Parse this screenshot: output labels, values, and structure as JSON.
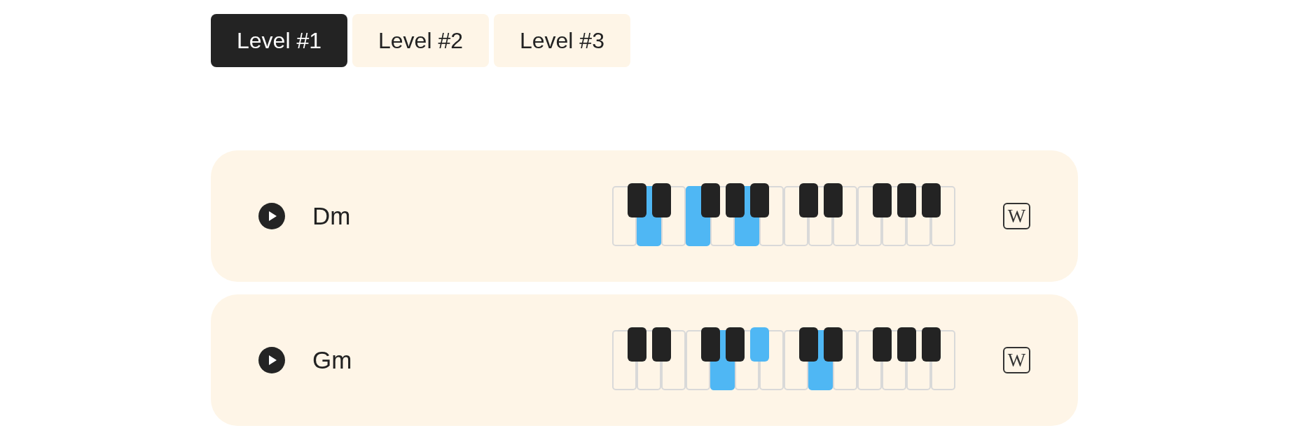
{
  "tabs": [
    {
      "label": "Level #1",
      "selected": true
    },
    {
      "label": "Level #2",
      "selected": false
    },
    {
      "label": "Level #3",
      "selected": false
    }
  ],
  "chords": [
    {
      "name": "Dm",
      "wiki_label": "W",
      "keys": [
        {
          "kind": "white",
          "highlighted": false
        },
        {
          "kind": "black",
          "highlighted": false
        },
        {
          "kind": "white",
          "highlighted": true
        },
        {
          "kind": "black",
          "highlighted": false
        },
        {
          "kind": "white",
          "highlighted": false
        },
        {
          "kind": "white",
          "highlighted": true
        },
        {
          "kind": "black",
          "highlighted": false
        },
        {
          "kind": "white",
          "highlighted": false
        },
        {
          "kind": "black",
          "highlighted": false
        },
        {
          "kind": "white",
          "highlighted": true
        },
        {
          "kind": "black",
          "highlighted": false
        },
        {
          "kind": "white",
          "highlighted": false
        },
        {
          "kind": "white",
          "highlighted": false
        },
        {
          "kind": "black",
          "highlighted": false
        },
        {
          "kind": "white",
          "highlighted": false
        },
        {
          "kind": "black",
          "highlighted": false
        },
        {
          "kind": "white",
          "highlighted": false
        },
        {
          "kind": "white",
          "highlighted": false
        },
        {
          "kind": "black",
          "highlighted": false
        },
        {
          "kind": "white",
          "highlighted": false
        },
        {
          "kind": "black",
          "highlighted": false
        },
        {
          "kind": "white",
          "highlighted": false
        },
        {
          "kind": "black",
          "highlighted": false
        },
        {
          "kind": "white",
          "highlighted": false
        }
      ]
    },
    {
      "name": "Gm",
      "wiki_label": "W",
      "keys": [
        {
          "kind": "white",
          "highlighted": false
        },
        {
          "kind": "black",
          "highlighted": false
        },
        {
          "kind": "white",
          "highlighted": false
        },
        {
          "kind": "black",
          "highlighted": false
        },
        {
          "kind": "white",
          "highlighted": false
        },
        {
          "kind": "white",
          "highlighted": false
        },
        {
          "kind": "black",
          "highlighted": false
        },
        {
          "kind": "white",
          "highlighted": true
        },
        {
          "kind": "black",
          "highlighted": false
        },
        {
          "kind": "white",
          "highlighted": false
        },
        {
          "kind": "black",
          "highlighted": true
        },
        {
          "kind": "white",
          "highlighted": false
        },
        {
          "kind": "white",
          "highlighted": false
        },
        {
          "kind": "black",
          "highlighted": false
        },
        {
          "kind": "white",
          "highlighted": true
        },
        {
          "kind": "black",
          "highlighted": false
        },
        {
          "kind": "white",
          "highlighted": false
        },
        {
          "kind": "white",
          "highlighted": false
        },
        {
          "kind": "black",
          "highlighted": false
        },
        {
          "kind": "white",
          "highlighted": false
        },
        {
          "kind": "black",
          "highlighted": false
        },
        {
          "kind": "white",
          "highlighted": false
        },
        {
          "kind": "black",
          "highlighted": false
        },
        {
          "kind": "white",
          "highlighted": false
        }
      ]
    }
  ]
}
